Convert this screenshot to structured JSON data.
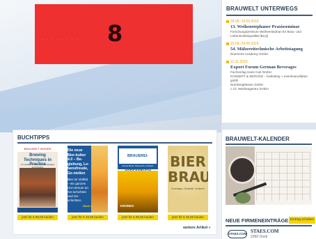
{
  "banner": {
    "number": "8"
  },
  "sidebar": {
    "unterwegs_title": "BRAUWELT UNTERWEGS",
    "events": [
      {
        "date": "18.09.-19.09.2019",
        "name": "13. Weihenstephaner Praxisseminar",
        "location": "Forschungszentrum Weihenstephan für Brau- und Lebensmittelqualität (BLQ)"
      },
      {
        "date": "23.09.-24.09.2019",
        "name": "54. Mälzereitechnische Arbeitstagung",
        "location": "Doemens Academy GmbH"
      },
      {
        "date": "12.11.2019",
        "name": "Export Forum German Beverages",
        "location": "Fachverlag Hans Carl GmbH\nKONZEPT & SERVICE - marketing + eventmanufaktur gmbh\nNürnbergMesse GmbH\nc.t.b. Werbeagentur GmbH"
      }
    ],
    "kalender_title": "BRAUWELT-KALENDER",
    "firmen_title": "NEUE FIRMENEINTRÄGE",
    "firmen_button": "Eintrag schalten",
    "firmen_logo": "STAES.COM",
    "firmen_name": "STAES.COM",
    "firmen_city": "2390 Oosti"
  },
  "books": {
    "title": "BUCHTIPPS",
    "items": [
      {
        "header": "BRAUWELT WISSEN",
        "title": "Brewing Techniques in Practice",
        "subtitle": "An Update on Brewing Technologies and Practice",
        "buy": "jetzt für € 99,00 kaufen"
      },
      {
        "title": "Die neue Bier-kultur 4.0 – Be-gleitung, Le-bensfreude, Ge-nießen",
        "text": "Bier ist Vielfalt – ein ganzes Uni-versum an Ge-schichten und Ge-schichten.",
        "edition": "Stufe 4",
        "buy": "jetzt für € 29,90 kaufen"
      },
      {
        "title": "BRAUEREI-ADRESSBUCH",
        "subtitle": "Deutschland, Österreich, Schweiz",
        "brand": "KRONES",
        "buy": "jetzt für € 99,00 kaufen"
      },
      {
        "title": "BIER BRAUEN",
        "subtitle": "Grundlagen, Rohstoffe, Verfahren",
        "buy": "jetzt für € 49,90 kaufen"
      }
    ],
    "more": "weitere Artikel »"
  },
  "colors": {
    "banner": "#ee3030",
    "accent": "#f5d400",
    "navy": "#2b3f57"
  }
}
